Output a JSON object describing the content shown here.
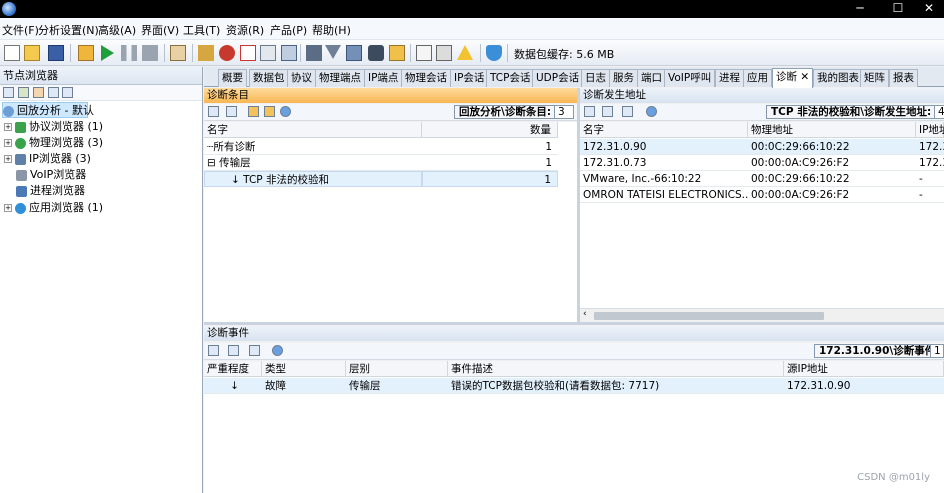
{
  "window": {
    "minimize": "─",
    "maximize": "☐",
    "close": "✕"
  },
  "menu": [
    "文件(F)",
    "分析设置(N)",
    "高级(A)",
    "界面(V)",
    "工具(T)",
    "资源(R)",
    "产品(P)",
    "帮助(H)"
  ],
  "toolbar": {
    "buffer_label": "数据包缓存:",
    "buffer_value": "5.6 MB"
  },
  "node_browser": {
    "title": "节点浏览器",
    "items": [
      {
        "label": "回放分析 - 默认",
        "selected": true,
        "icon": "replay-icon"
      },
      {
        "label": "协议浏览器 (1)",
        "icon": "protocol-icon"
      },
      {
        "label": "物理浏览器 (3)",
        "icon": "physical-icon"
      },
      {
        "label": "IP浏览器 (3)",
        "icon": "ip-icon"
      },
      {
        "label": "VoIP浏览器",
        "icon": "voip-icon"
      },
      {
        "label": "进程浏览器",
        "icon": "process-icon"
      },
      {
        "label": "应用浏览器 (1)",
        "icon": "app-icon"
      }
    ]
  },
  "tabs": [
    "概要",
    "数据包",
    "协议",
    "物理端点",
    "IP端点",
    "物理会话",
    "IP会话",
    "TCP会话",
    "UDP会话",
    "日志",
    "服务",
    "端口",
    "VoIP呼叫",
    "进程",
    "应用",
    "诊断",
    "我的图表",
    "矩阵",
    "报表"
  ],
  "active_tab": "诊断",
  "diag_items": {
    "title": "诊断条目",
    "filter_label": "回放分析\\诊断条目:",
    "filter_value": "3",
    "columns": [
      "名字",
      "数量"
    ],
    "rows": [
      {
        "name": "所有诊断",
        "count": "1"
      },
      {
        "name": "传输层",
        "count": "1"
      },
      {
        "name": "TCP 非法的校验和",
        "count": "1"
      }
    ]
  },
  "diag_addresses": {
    "title": "诊断发生地址",
    "filter_label": "TCP 非法的校验和\\诊断发生地址:",
    "filter_value": "4",
    "columns": [
      "名字",
      "物理地址",
      "IP地址"
    ],
    "rows": [
      {
        "name": "172.31.0.90",
        "mac": "00:0C:29:66:10:22",
        "ip": "172.3"
      },
      {
        "name": "172.31.0.73",
        "mac": "00:00:0A:C9:26:F2",
        "ip": "172.3"
      },
      {
        "name": "VMware, Inc.-66:10:22",
        "mac": "00:0C:29:66:10:22",
        "ip": "-"
      },
      {
        "name": "OMRON TATEISI ELECTRONICS...",
        "mac": "00:00:0A:C9:26:F2",
        "ip": "-"
      }
    ]
  },
  "diag_events": {
    "title": "诊断事件",
    "filter_label": "172.31.0.90\\诊断事件:",
    "filter_value": "1",
    "columns": [
      "严重程度",
      "类型",
      "层别",
      "事件描述",
      "源IP地址"
    ],
    "rows": [
      {
        "severity": "↓",
        "type": "故障",
        "layer": "传输层",
        "desc": "错误的TCP数据包校验和(请看数据包: 7717)",
        "src": "172.31.0.90"
      }
    ]
  },
  "watermark": "CSDN @m01ly",
  "colors": {
    "accent_orange": "#f7b653",
    "selection": "#cde8ff"
  }
}
